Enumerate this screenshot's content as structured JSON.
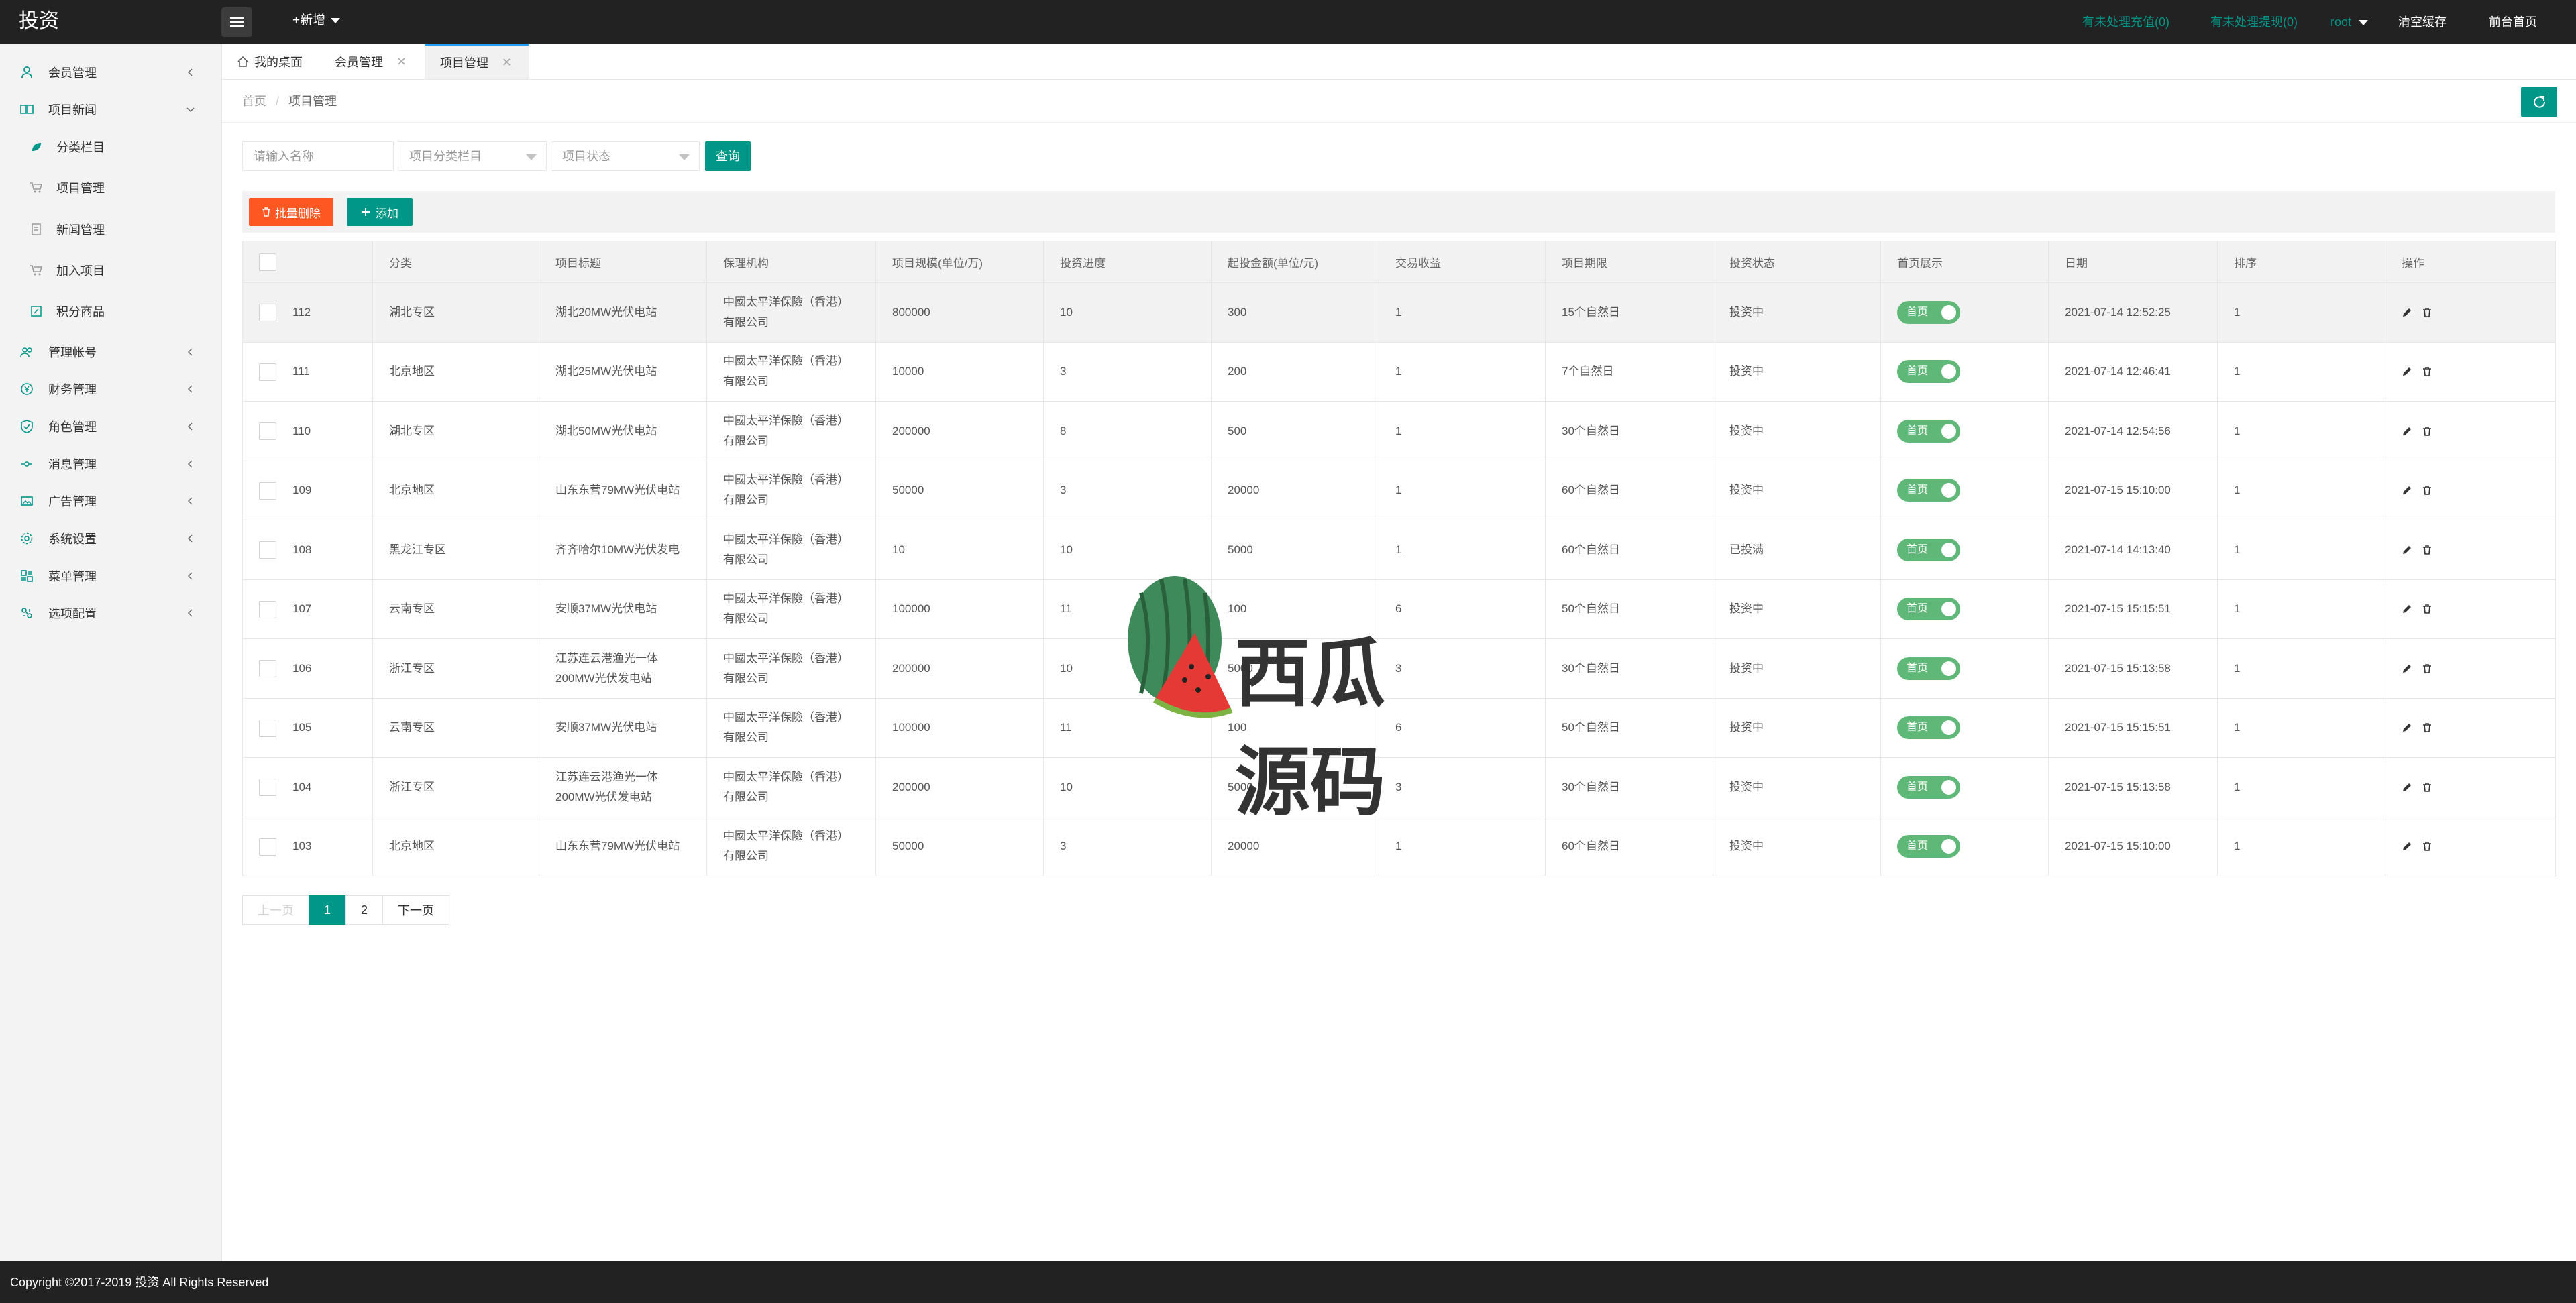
{
  "app": {
    "title": "投资"
  },
  "header": {
    "new_label": "+新增",
    "pending_recharge": "有未处理充值(0)",
    "pending_withdraw": "有未处理提现(0)",
    "user": "root",
    "clear_cache": "清空缓存",
    "front_home": "前台首页"
  },
  "sidebar": {
    "items": [
      {
        "label": "会员管理",
        "icon": "user-icon"
      },
      {
        "label": "项目新闻",
        "icon": "book-icon"
      },
      {
        "label": "分类栏目",
        "icon": "leaf-icon"
      },
      {
        "label": "项目管理",
        "icon": "cart-icon"
      },
      {
        "label": "新闻管理",
        "icon": "doc-icon"
      },
      {
        "label": "加入项目",
        "icon": "cart-icon"
      },
      {
        "label": "积分商品",
        "icon": "edit-icon"
      },
      {
        "label": "管理帐号",
        "icon": "users-icon"
      },
      {
        "label": "财务管理",
        "icon": "money-icon"
      },
      {
        "label": "角色管理",
        "icon": "shield-icon"
      },
      {
        "label": "消息管理",
        "icon": "message-icon"
      },
      {
        "label": "广告管理",
        "icon": "image-icon"
      },
      {
        "label": "系统设置",
        "icon": "gear-icon"
      },
      {
        "label": "菜单管理",
        "icon": "menu-icon"
      },
      {
        "label": "选项配置",
        "icon": "config-icon"
      }
    ]
  },
  "tabs": [
    {
      "label": "我的桌面"
    },
    {
      "label": "会员管理"
    },
    {
      "label": "项目管理"
    }
  ],
  "breadcrumb": {
    "home": "首页",
    "current": "项目管理"
  },
  "search": {
    "name_placeholder": "请输入名称",
    "category_placeholder": "项目分类栏目",
    "status_placeholder": "项目状态",
    "query_label": "查询"
  },
  "toolbar": {
    "batch_delete": "批量删除",
    "add": "添加"
  },
  "table": {
    "headers": [
      "",
      "分类",
      "项目标题",
      "保理机构",
      "项目规模(单位/万)",
      "投资进度",
      "起投金额(单位/元)",
      "交易收益",
      "项目期限",
      "投资状态",
      "首页展示",
      "日期",
      "排序",
      "操作"
    ],
    "rows": [
      {
        "id": "112",
        "category": "湖北专区",
        "title": "湖北20MW光伏电站",
        "agency": "中國太平洋保險（香港）有限公司",
        "scale": "800000",
        "progress": "10",
        "min_invest": "300",
        "yield": "1",
        "term": "15个自然日",
        "status": "投资中",
        "home": "首页",
        "date": "2021-07-14 12:52:25",
        "sort": "1"
      },
      {
        "id": "111",
        "category": "北京地区",
        "title": "湖北25MW光伏电站",
        "agency": "中國太平洋保險（香港）有限公司",
        "scale": "10000",
        "progress": "3",
        "min_invest": "200",
        "yield": "1",
        "term": "7个自然日",
        "status": "投资中",
        "home": "首页",
        "date": "2021-07-14 12:46:41",
        "sort": "1"
      },
      {
        "id": "110",
        "category": "湖北专区",
        "title": "湖北50MW光伏电站",
        "agency": "中國太平洋保險（香港）有限公司",
        "scale": "200000",
        "progress": "8",
        "min_invest": "500",
        "yield": "1",
        "term": "30个自然日",
        "status": "投资中",
        "home": "首页",
        "date": "2021-07-14 12:54:56",
        "sort": "1"
      },
      {
        "id": "109",
        "category": "北京地区",
        "title": "山东东营79MW光伏电站",
        "agency": "中國太平洋保險（香港）有限公司",
        "scale": "50000",
        "progress": "3",
        "min_invest": "20000",
        "yield": "1",
        "term": "60个自然日",
        "status": "投资中",
        "home": "首页",
        "date": "2021-07-15 15:10:00",
        "sort": "1"
      },
      {
        "id": "108",
        "category": "黑龙江专区",
        "title": "齐齐哈尔10MW光伏发电",
        "agency": "中國太平洋保險（香港）有限公司",
        "scale": "10",
        "progress": "10",
        "min_invest": "5000",
        "yield": "1",
        "term": "60个自然日",
        "status": "已投满",
        "home": "首页",
        "date": "2021-07-14 14:13:40",
        "sort": "1"
      },
      {
        "id": "107",
        "category": "云南专区",
        "title": "安顺37MW光伏电站",
        "agency": "中國太平洋保險（香港）有限公司",
        "scale": "100000",
        "progress": "11",
        "min_invest": "100",
        "yield": "6",
        "term": "50个自然日",
        "status": "投资中",
        "home": "首页",
        "date": "2021-07-15 15:15:51",
        "sort": "1"
      },
      {
        "id": "106",
        "category": "浙江专区",
        "title": "江苏连云港渔光一体200MW光伏发电站",
        "agency": "中國太平洋保險（香港）有限公司",
        "scale": "200000",
        "progress": "10",
        "min_invest": "5000",
        "yield": "3",
        "term": "30个自然日",
        "status": "投资中",
        "home": "首页",
        "date": "2021-07-15 15:13:58",
        "sort": "1"
      },
      {
        "id": "105",
        "category": "云南专区",
        "title": "安顺37MW光伏电站",
        "agency": "中國太平洋保險（香港）有限公司",
        "scale": "100000",
        "progress": "11",
        "min_invest": "100",
        "yield": "6",
        "term": "50个自然日",
        "status": "投资中",
        "home": "首页",
        "date": "2021-07-15 15:15:51",
        "sort": "1"
      },
      {
        "id": "104",
        "category": "浙江专区",
        "title": "江苏连云港渔光一体200MW光伏发电站",
        "agency": "中國太平洋保險（香港）有限公司",
        "scale": "200000",
        "progress": "10",
        "min_invest": "5000",
        "yield": "3",
        "term": "30个自然日",
        "status": "投资中",
        "home": "首页",
        "date": "2021-07-15 15:13:58",
        "sort": "1"
      },
      {
        "id": "103",
        "category": "北京地区",
        "title": "山东东营79MW光伏电站",
        "agency": "中國太平洋保險（香港）有限公司",
        "scale": "50000",
        "progress": "3",
        "min_invest": "20000",
        "yield": "1",
        "term": "60个自然日",
        "status": "投资中",
        "home": "首页",
        "date": "2021-07-15 15:10:00",
        "sort": "1"
      }
    ]
  },
  "pagination": {
    "prev": "上一页",
    "pages": [
      "1",
      "2"
    ],
    "current": "1",
    "next": "下一页"
  },
  "watermark": {
    "text": "西瓜源码"
  },
  "footer": {
    "copyright": "Copyright ©2017-2019 投资 All Rights Reserved"
  },
  "colors": {
    "primary": "#009688",
    "danger": "#ff5722",
    "switch_on": "#5fb878",
    "header_bg": "#222222"
  }
}
